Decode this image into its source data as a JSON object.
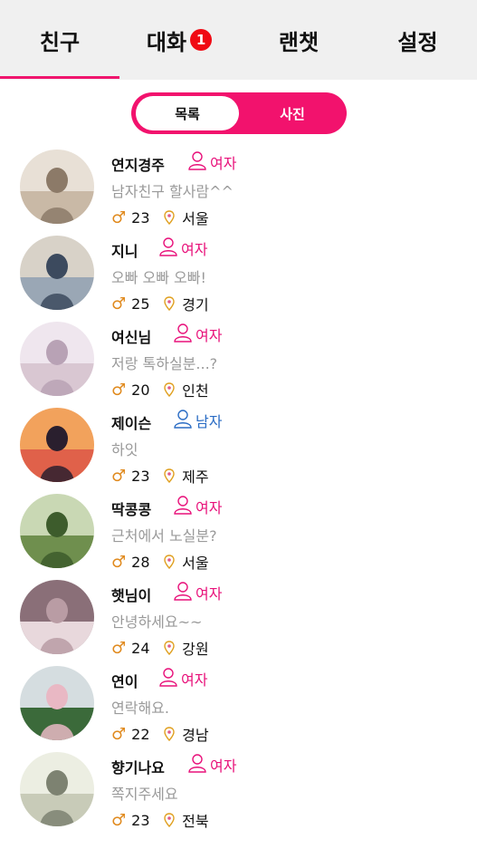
{
  "tabs": [
    {
      "label": "친구"
    },
    {
      "label": "대화",
      "badge": "1"
    },
    {
      "label": "랜챗"
    },
    {
      "label": "설정"
    }
  ],
  "segment": {
    "list_label": "목록",
    "photo_label": "사진"
  },
  "colors": {
    "accent": "#f0156e",
    "female": "#e8117a",
    "male": "#2a6cc4",
    "badge": "#f00a14"
  },
  "friends": [
    {
      "name": "연지경주",
      "gender": "여자",
      "status": "남자친구 할사람^^",
      "age": "23",
      "region": "서울"
    },
    {
      "name": "지니",
      "gender": "여자",
      "status": "오빠 오빠 오빠!",
      "age": "25",
      "region": "경기"
    },
    {
      "name": "여신님",
      "gender": "여자",
      "status": "저랑 톡하실분...?",
      "age": "20",
      "region": "인천"
    },
    {
      "name": "제이슨",
      "gender": "남자",
      "status": "하잇",
      "age": "23",
      "region": "제주"
    },
    {
      "name": "딱콩콩",
      "gender": "여자",
      "status": "근처에서 노실분?",
      "age": "28",
      "region": "서울"
    },
    {
      "name": "햇님이",
      "gender": "여자",
      "status": "안녕하세요~~",
      "age": "24",
      "region": "강원"
    },
    {
      "name": "연이",
      "gender": "여자",
      "status": "연락해요.",
      "age": "22",
      "region": "경남"
    },
    {
      "name": "향기나요",
      "gender": "여자",
      "status": "쪽지주세요",
      "age": "23",
      "region": "전북"
    }
  ]
}
